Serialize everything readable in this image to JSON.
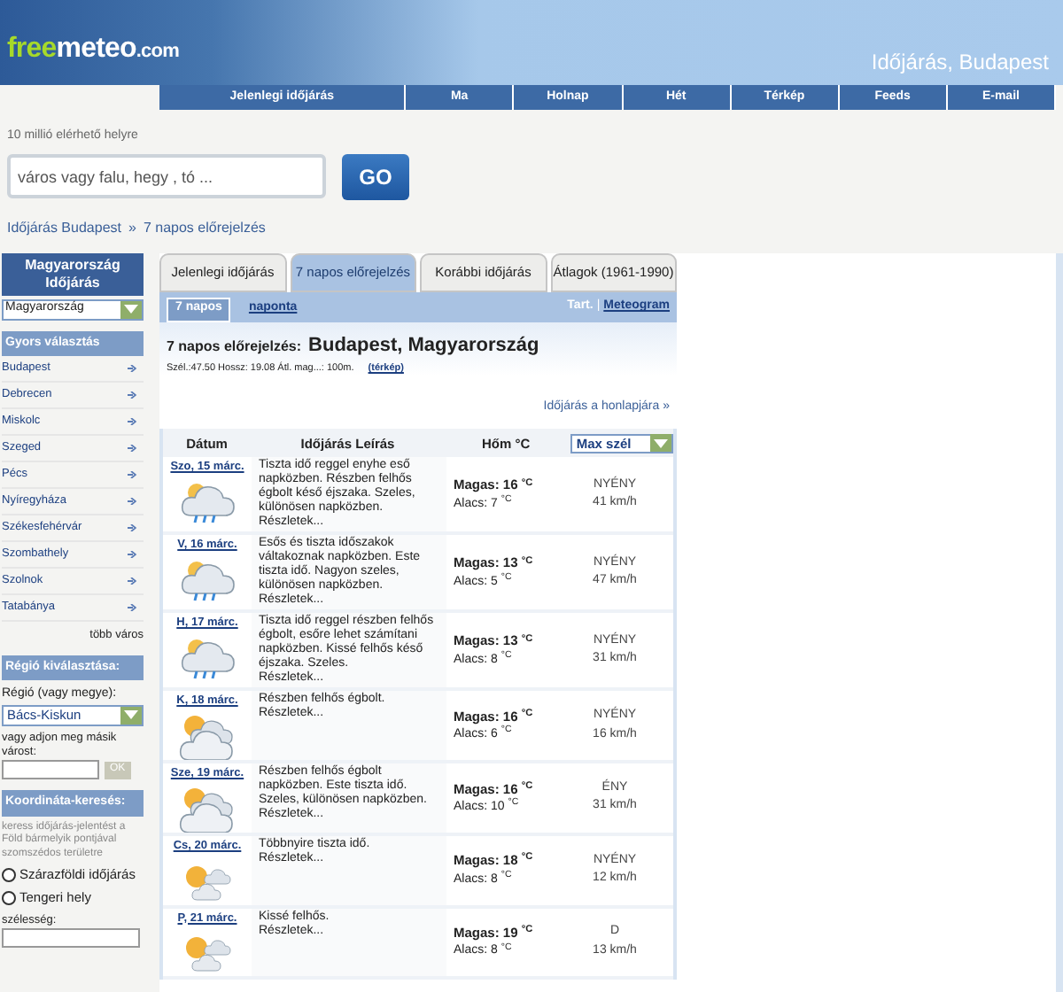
{
  "header": {
    "logo_free": "free",
    "logo_meteo": "meteo",
    "logo_com": ".com",
    "subtitle": "Időjárás, Budapest"
  },
  "nav": [
    "Jelenlegi időjárás",
    "Ma",
    "Holnap",
    "Hét",
    "Térkép",
    "Feeds",
    "E-mail"
  ],
  "search": {
    "hint": "10 millió elérhető helyre",
    "placeholder": "város vagy falu, hegy , tó ...",
    "button": "GO"
  },
  "breadcrumb": [
    {
      "label": "Időjárás Budapest"
    },
    {
      "label": "7 napos előrejelzés"
    }
  ],
  "breadcrumb_sep": "»",
  "sidebar": {
    "title": "Magyarország Időjárás",
    "country": "Magyarország",
    "quick_title": "Gyors választás",
    "cities": [
      "Budapest",
      "Debrecen",
      "Miskolc",
      "Szeged",
      "Pécs",
      "Nyíregyháza",
      "Székesfehérvár",
      "Szombathely",
      "Szolnok",
      "Tatabánya"
    ],
    "more": "több város",
    "region_title": "Régió kiválasztása:",
    "region_label": "Régió (vagy megye):",
    "region": "Bács-Kiskun",
    "other_label": "vagy adjon meg másik várost:",
    "ok": "OK",
    "coord_title": "Koordináta-keresés:",
    "coord_text": "keress időjárás-jelentést a Föld bármelyik pontjával szomszédos területre",
    "radios": [
      {
        "label": "Szárazföldi időjárás",
        "selected": false
      },
      {
        "label": "Tengeri hely",
        "selected": false
      }
    ],
    "lat_label": "szélesség:"
  },
  "tabs": [
    {
      "label": "Jelenlegi időjárás",
      "selected": false
    },
    {
      "label": "7 napos előrejelzés",
      "selected": true
    },
    {
      "label": "Korábbi időjárás",
      "selected": false
    },
    {
      "label": "Átlagok (1961-1990)",
      "selected": false
    }
  ],
  "subtabs": [
    {
      "label": "7 napos",
      "selected": true
    },
    {
      "label": "naponta",
      "selected": false
    }
  ],
  "tart": "Tart.",
  "tart_sep": "|",
  "meteogram": "Meteogram",
  "forecast_label": "7 napos előrejelzés:",
  "place": "Budapest, Magyarország",
  "coords": "Szél.:47.50 Hossz: 19.08 Átl. mag...: 100m.",
  "map_link": "(térkép)",
  "homepage_link": "Időjárás a honlapjára »",
  "columns": [
    "Dátum",
    "Időjárás Leírás",
    "Hőm °C"
  ],
  "wind_select": "Max szél",
  "rows": [
    {
      "date": "Szo, 15 márc.",
      "kind": "rain",
      "desc": "Tiszta idő reggel  enyhe eső napközben. Részben felhős égbolt késő éjszaka. Szeles, különösen napközben.",
      "details": "Részletek...",
      "high": "Magas: 16",
      "high_unit": "°C",
      "low": "Alacs: 7",
      "low_unit": "°C",
      "dir": "NYÉNY",
      "speed": "41 km/h"
    },
    {
      "date": "V, 16 márc.",
      "kind": "rain",
      "desc": "Esős és tiszta időszakok váltakoznak napközben. Este tiszta idő. Nagyon szeles, különösen napközben.",
      "details": "Részletek...",
      "high": "Magas: 13",
      "high_unit": "°C",
      "low": "Alacs: 5",
      "low_unit": "°C",
      "dir": "NYÉNY",
      "speed": "47 km/h"
    },
    {
      "date": "H, 17 márc.",
      "kind": "rain",
      "desc": "Tiszta idő reggel  részben felhős égbolt, esőre lehet számítani napközben. Kissé felhős késő éjszaka. Szeles.",
      "details": "Részletek...",
      "high": "Magas: 13",
      "high_unit": "°C",
      "low": "Alacs: 8",
      "low_unit": "°C",
      "dir": "NYÉNY",
      "speed": "31 km/h"
    },
    {
      "date": "K, 18 márc.",
      "kind": "cloudy",
      "desc": "Részben felhős égbolt.",
      "details": "Részletek...",
      "high": "Magas: 16",
      "high_unit": "°C",
      "low": "Alacs: 6",
      "low_unit": "°C",
      "dir": "NYÉNY",
      "speed": "16 km/h"
    },
    {
      "date": "Sze, 19 márc.",
      "kind": "cloudy",
      "desc": "Részben felhős égbolt napközben. Este tiszta idő. Szeles, különösen napközben.",
      "details": "Részletek...",
      "high": "Magas: 16",
      "high_unit": "°C",
      "low": "Alacs: 10",
      "low_unit": "°C",
      "dir": "ÉNY",
      "speed": "31 km/h"
    },
    {
      "date": "Cs, 20 márc.",
      "kind": "sunny",
      "desc": "Többnyire tiszta idő.",
      "details": "Részletek...",
      "high": "Magas: 18",
      "high_unit": "°C",
      "low": "Alacs: 8",
      "low_unit": "°C",
      "dir": "NYÉNY",
      "speed": "12 km/h"
    },
    {
      "date": "P, 21 márc.",
      "kind": "sunny",
      "desc": "Kissé felhős.",
      "details": "Részletek...",
      "high": "Magas: 19",
      "high_unit": "°C",
      "low": "Alacs: 8",
      "low_unit": "°C",
      "dir": "D",
      "speed": "13 km/h"
    }
  ]
}
